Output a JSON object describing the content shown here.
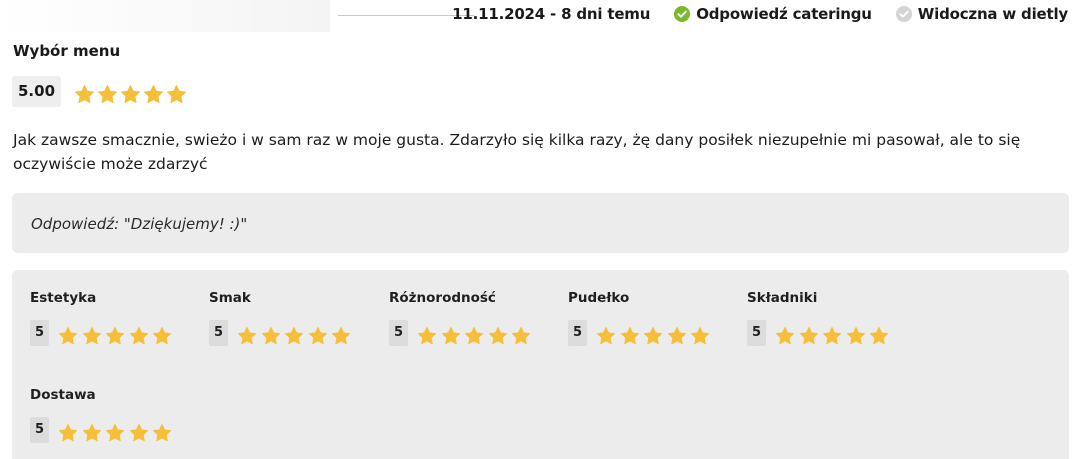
{
  "header": {
    "date_text": "11.11.2024 - 8 dni temu",
    "catering_reply_label": "Odpowiedź cateringu",
    "visible_in_diet_label": "Widoczna w dietly",
    "catering_reply_icon": "check-circle-green",
    "visible_icon": "check-circle-gray",
    "colors": {
      "green": "#7cb82f",
      "gray": "#d4d4d4",
      "star": "#f5bf3a"
    }
  },
  "review": {
    "menu_title": "Wybór menu",
    "overall_score": "5.00",
    "overall_stars": 5,
    "text": "Jak zawsze smacznie, swieżo i w sam raz w moje gusta. Zdarzyło się kilka razy, żę dany posiłek niezupełnie mi pasował, ale to się oczywiście może zdarzyć",
    "answer": "Odpowiedź: \"Dziękujemy! :)\""
  },
  "categories": [
    {
      "label": "Estetyka",
      "score": "5",
      "stars": 5
    },
    {
      "label": "Smak",
      "score": "5",
      "stars": 5
    },
    {
      "label": "Różnorodność",
      "score": "5",
      "stars": 5
    },
    {
      "label": "Pudełko",
      "score": "5",
      "stars": 5
    },
    {
      "label": "Składniki",
      "score": "5",
      "stars": 5
    },
    {
      "label": "Dostawa",
      "score": "5",
      "stars": 5
    }
  ]
}
